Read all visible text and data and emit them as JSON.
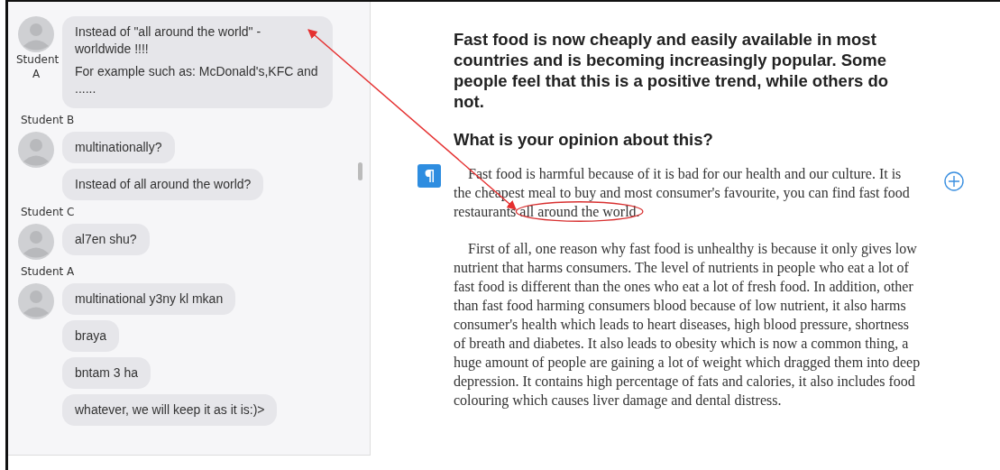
{
  "chat": {
    "groups": [
      {
        "sender": "Student A",
        "kind": "label_beside",
        "messages": [
          [
            "Instead of \"all around the world\" - worldwide !!!!",
            "For example such as: McDonald's,KFC and ......"
          ]
        ]
      },
      {
        "sender": "Student B",
        "kind": "label_above",
        "messages": [
          [
            "multinationally?"
          ],
          [
            "Instead of all around the world?"
          ]
        ]
      },
      {
        "sender": "Student C",
        "kind": "label_above",
        "messages": [
          [
            "al7en shu?"
          ]
        ]
      },
      {
        "sender": "Student A",
        "kind": "label_above",
        "messages": [
          [
            "multinational y3ny kl mkan"
          ],
          [
            "braya"
          ],
          [
            "bntam 3 ha"
          ],
          [
            "whatever, we will keep it as it is:)>"
          ]
        ]
      }
    ]
  },
  "essay": {
    "prompt": "Fast food is now cheaply and easily available in most countries and is becoming increasingly popular. Some people feel that this is a positive trend, while others do not.",
    "question": "What is your opinion about this?",
    "paragraphs": [
      {
        "segments": [
          {
            "text": "Fast food is harmful because of it is bad for our health and our culture. It is the cheapest meal to buy and most consumer's favourite, you can find fast food restaurants ",
            "circled": false
          },
          {
            "text": "all around the world.",
            "circled": true
          }
        ]
      },
      {
        "segments": [
          {
            "text": "First of all, one reason why fast food is unhealthy is because it only gives low nutrient that harms consumers. The level of nutrients in people who eat a lot of fast food is different than the ones  who eat a lot of fresh food. In addition, other than fast food harming consumers blood because of low nutrient, it also harms consumer's health which leads to heart diseases, high blood pressure, shortness of breath and diabetes. It also leads to obesity which is now a common thing, a huge amount of people are gaining a lot of weight which dragged them into deep depression. It contains high percentage of fats and calories, it also includes food colouring which causes liver damage and dental distress.",
            "circled": false
          }
        ]
      }
    ]
  }
}
